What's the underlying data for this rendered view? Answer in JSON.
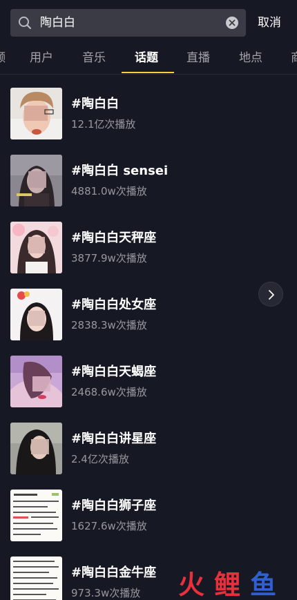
{
  "search": {
    "query": "陶白白",
    "cancel_label": "取消"
  },
  "tabs": [
    {
      "label": "频",
      "active": false
    },
    {
      "label": "用户",
      "active": false
    },
    {
      "label": "音乐",
      "active": false
    },
    {
      "label": "话题",
      "active": true
    },
    {
      "label": "直播",
      "active": false
    },
    {
      "label": "地点",
      "active": false
    },
    {
      "label": "商",
      "active": false
    }
  ],
  "topics": [
    {
      "title": "#陶白白",
      "views": "12.1亿次播放"
    },
    {
      "title": "#陶白白 sensei",
      "views": "4881.0w次播放"
    },
    {
      "title": "#陶白白天秤座",
      "views": "3877.9w次播放"
    },
    {
      "title": "#陶白白处女座",
      "views": "2838.3w次播放"
    },
    {
      "title": "#陶白白天蝎座",
      "views": "2468.6w次播放"
    },
    {
      "title": "#陶白白讲星座",
      "views": "2.4亿次播放"
    },
    {
      "title": "#陶白白狮子座",
      "views": "1627.6w次播放"
    },
    {
      "title": "#陶白白金牛座",
      "views": "973.3w次播放"
    }
  ],
  "watermark": {
    "chars": [
      "火",
      "鲤",
      "鱼"
    ]
  },
  "colors": {
    "background": "#161823",
    "accent_underline": "#facd3d",
    "watermark_red": "#e8303c",
    "watermark_blue": "#2f5fd0"
  }
}
